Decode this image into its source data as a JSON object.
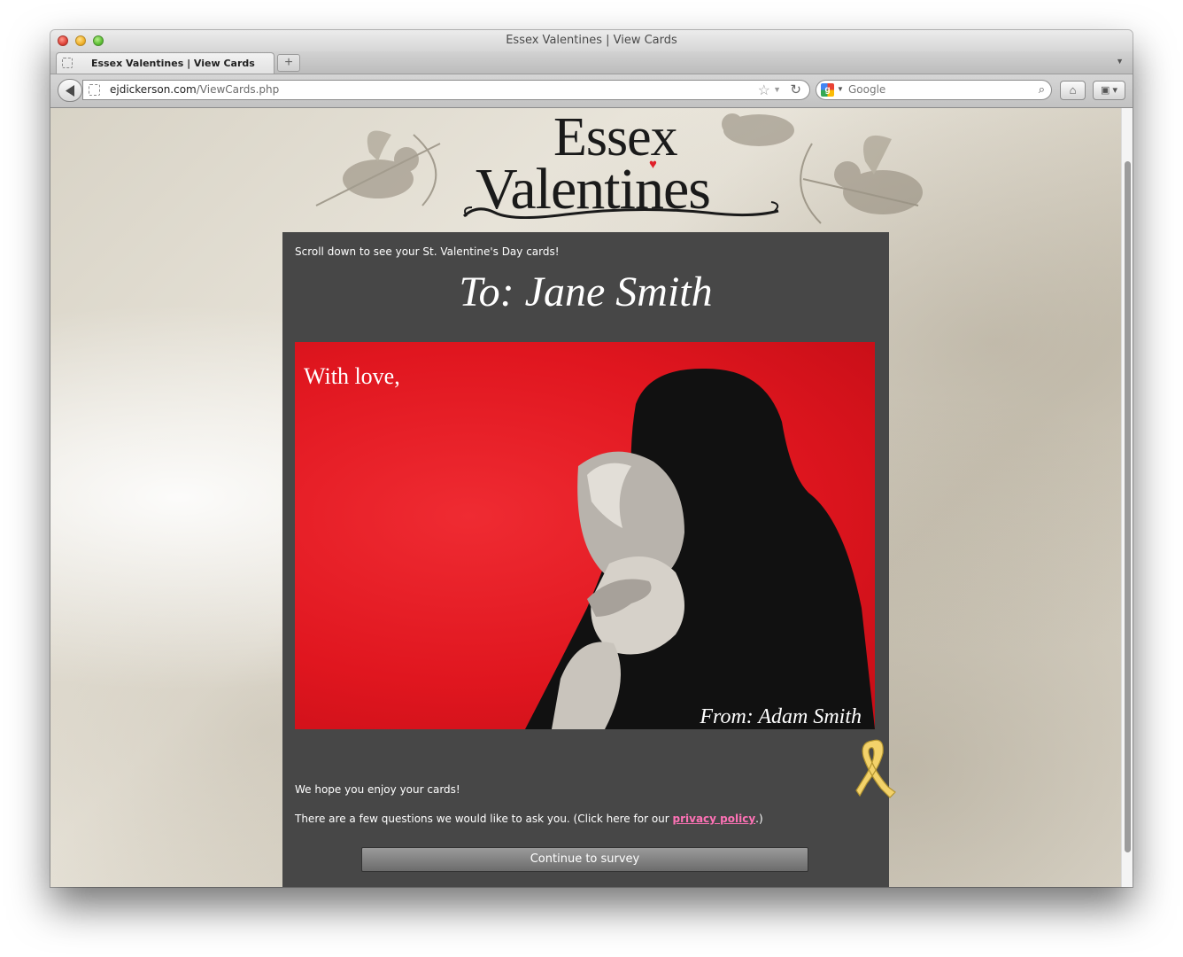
{
  "window": {
    "title": "Essex Valentines | View Cards"
  },
  "tabs": [
    {
      "label": "Essex Valentines | View Cards"
    }
  ],
  "toolbar": {
    "url_domain": "ejdickerson.com",
    "url_path": "/ViewCards.php",
    "search_engine_icon": "g",
    "search_placeholder": "Google",
    "new_tab_label": "+"
  },
  "logo": {
    "line1": "Essex",
    "line2": "Valentines"
  },
  "page": {
    "intro": "Scroll down to see your St. Valentine's Day cards!",
    "to_heading": "To: Jane Smith",
    "card": {
      "greeting": "With love,",
      "from": "From: Adam Smith"
    },
    "thanks": "We hope you enjoy your cards!",
    "questions_prefix": "There are a few questions we would like to ask you. (Click here for our ",
    "privacy_link": "privacy policy",
    "questions_suffix": ".)",
    "survey_button": "Continue to survey"
  },
  "colors": {
    "panel_bg": "#474747",
    "card_red": "#e0161f",
    "link_pink": "#ff72b6",
    "ribbon_yellow": "#f3d26a"
  }
}
